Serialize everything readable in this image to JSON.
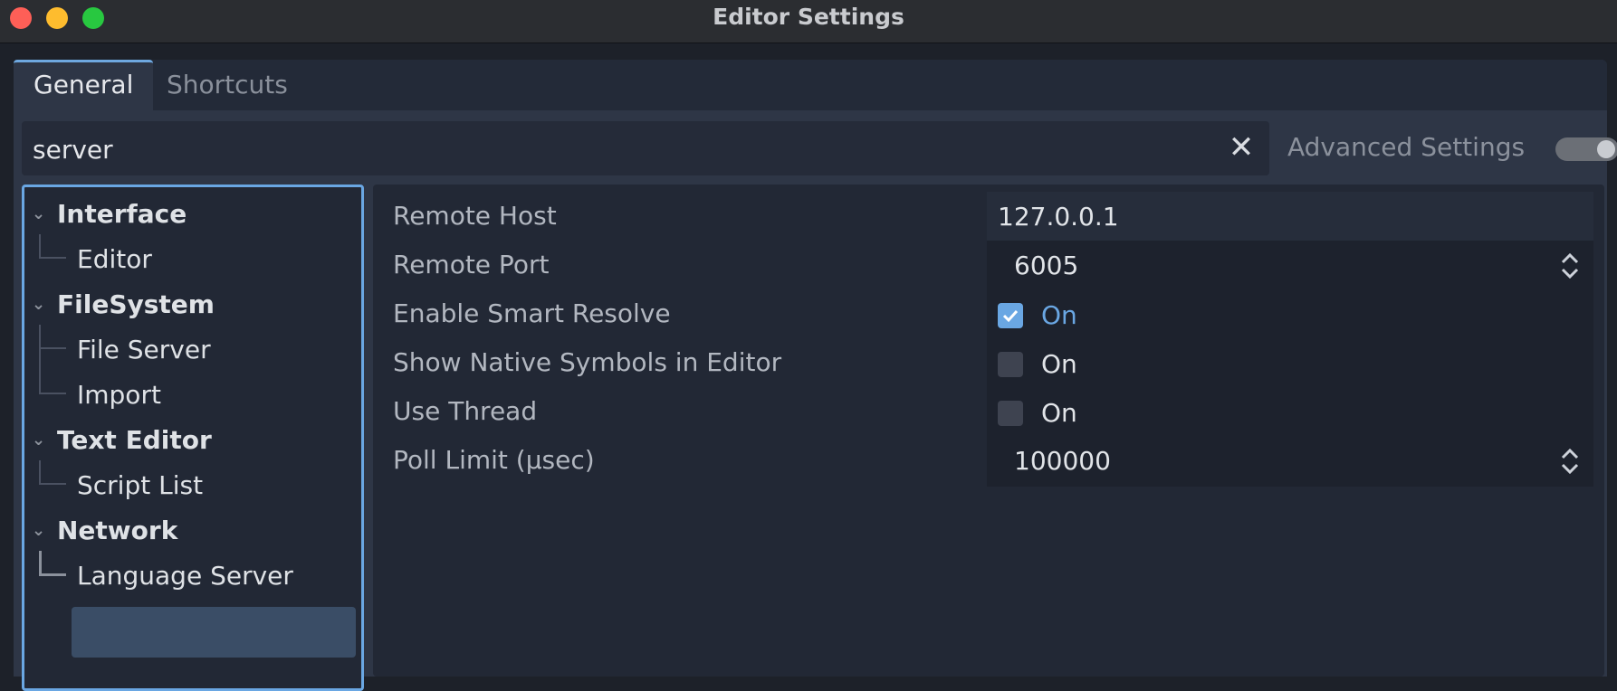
{
  "window": {
    "title": "Editor Settings"
  },
  "tabs": [
    {
      "label": "General",
      "active": true
    },
    {
      "label": "Shortcuts",
      "active": false
    }
  ],
  "search": {
    "value": "server"
  },
  "advanced": {
    "label": "Advanced Settings",
    "enabled": false
  },
  "tree": {
    "items": [
      {
        "label": "Interface",
        "level": 0
      },
      {
        "label": "Editor",
        "level": 1
      },
      {
        "label": "FileSystem",
        "level": 0
      },
      {
        "label": "File Server",
        "level": 1
      },
      {
        "label": "Import",
        "level": 1
      },
      {
        "label": "Text Editor",
        "level": 0
      },
      {
        "label": "Script List",
        "level": 1
      },
      {
        "label": "Network",
        "level": 0
      },
      {
        "label": "Language Server",
        "level": 1,
        "selected": true
      }
    ]
  },
  "properties": {
    "remote_host": {
      "label": "Remote Host",
      "value": "127.0.0.1"
    },
    "remote_port": {
      "label": "Remote Port",
      "value": "6005"
    },
    "smart_resolve": {
      "label": "Enable Smart Resolve",
      "checked": true,
      "text": "On"
    },
    "native_symbols": {
      "label": "Show Native Symbols in Editor",
      "checked": false,
      "text": "On"
    },
    "use_thread": {
      "label": "Use Thread",
      "checked": false,
      "text": "On"
    },
    "poll_limit": {
      "label": "Poll Limit (μsec)",
      "value": "100000"
    }
  },
  "colors": {
    "accent": "#6aa7e3",
    "selection": "#3a4d66"
  }
}
